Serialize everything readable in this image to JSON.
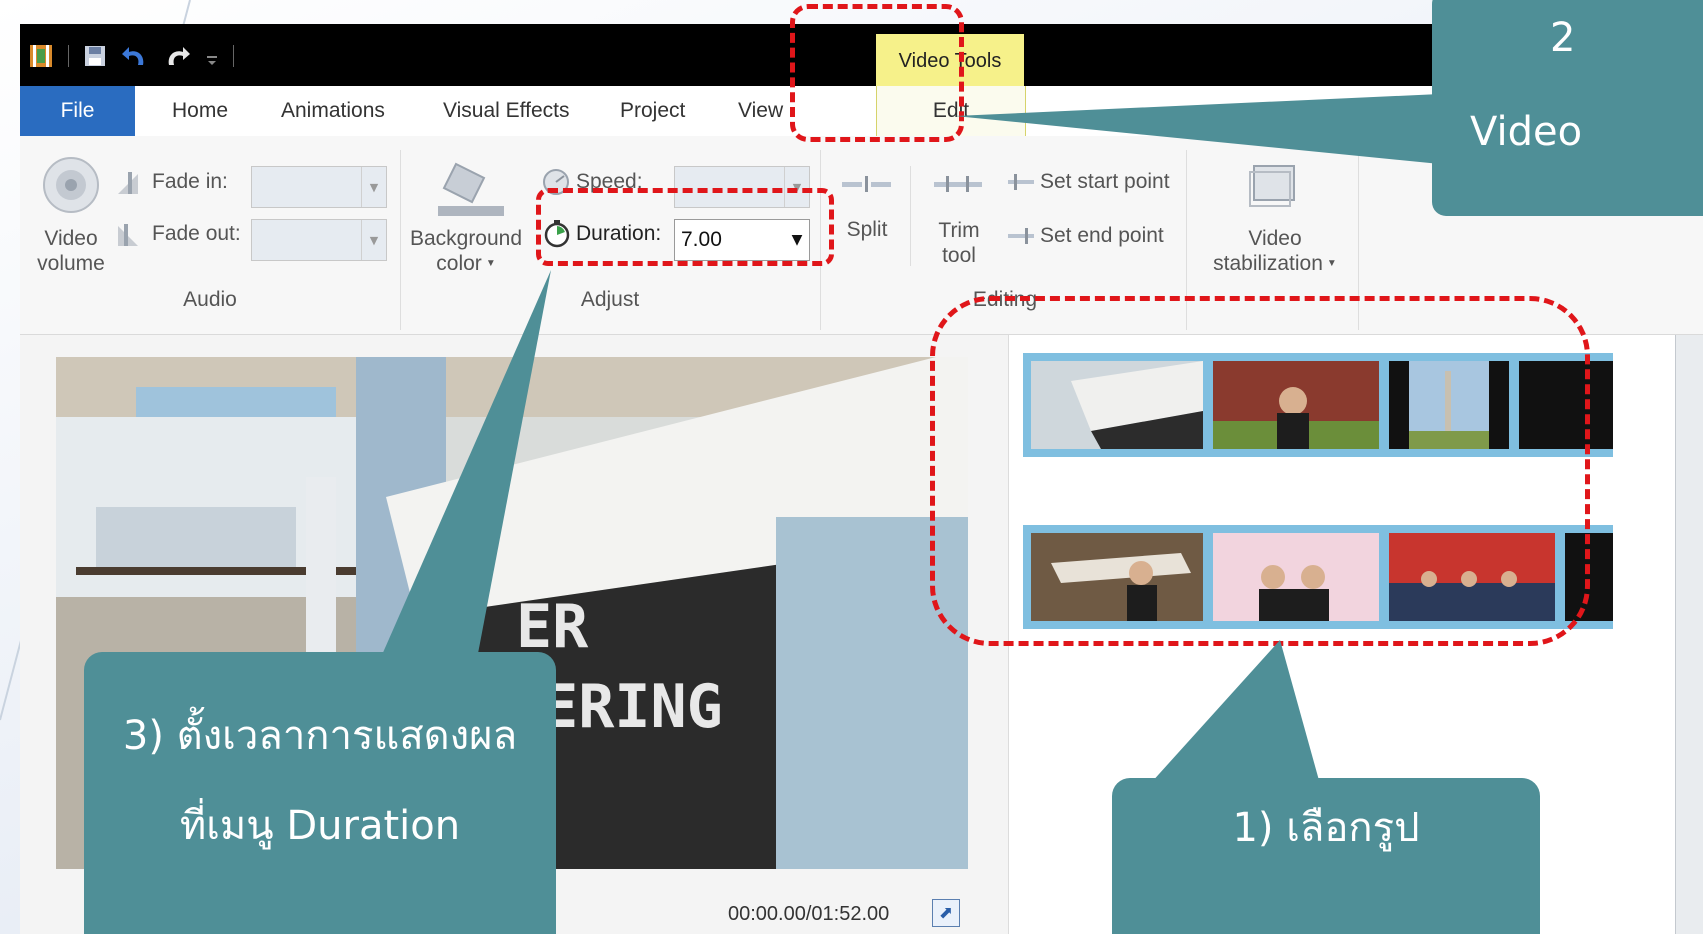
{
  "qat": {
    "icons": [
      "film-icon",
      "save-icon",
      "undo-icon",
      "redo-icon",
      "customize-icon"
    ]
  },
  "context_tab": {
    "label": "Video Tools"
  },
  "tabs": [
    {
      "label": "File"
    },
    {
      "label": "Home"
    },
    {
      "label": "Animations"
    },
    {
      "label": "Visual Effects"
    },
    {
      "label": "Project"
    },
    {
      "label": "View"
    },
    {
      "label": "Edit"
    }
  ],
  "ribbon": {
    "audio": {
      "video_volume_line1": "Video",
      "video_volume_line2": "volume",
      "fade_in_label": "Fade in:",
      "fade_out_label": "Fade out:",
      "group_label": "Audio"
    },
    "adjust": {
      "bg_color_line1": "Background",
      "bg_color_line2": "color",
      "speed_label": "Speed:",
      "duration_label": "Duration:",
      "duration_value": "7.00",
      "group_label": "Adjust"
    },
    "editing": {
      "split_label": "Split",
      "trim_line1": "Trim",
      "trim_line2": "tool",
      "set_start_label": "Set start point",
      "set_end_label": "Set end point",
      "group_label": "Editing"
    },
    "stabilization": {
      "line1": "Video",
      "line2": "stabilization"
    }
  },
  "preview": {
    "timecode": "00:00.00/01:52.00"
  },
  "callouts": {
    "step3_line1": "3) ตั้งเวลาการแสดงผล",
    "step3_line2": "ที่เมนู Duration",
    "step1": "1) เลือกรูป",
    "step2_line1": "2",
    "step2_line2": "Video"
  },
  "colors": {
    "callout_bg": "#4f8f97",
    "highlight_dash": "#e0161a",
    "file_tab": "#2a6cc0",
    "context_tab": "#f6f18a",
    "storyboard_strip": "#7fbfe0"
  }
}
